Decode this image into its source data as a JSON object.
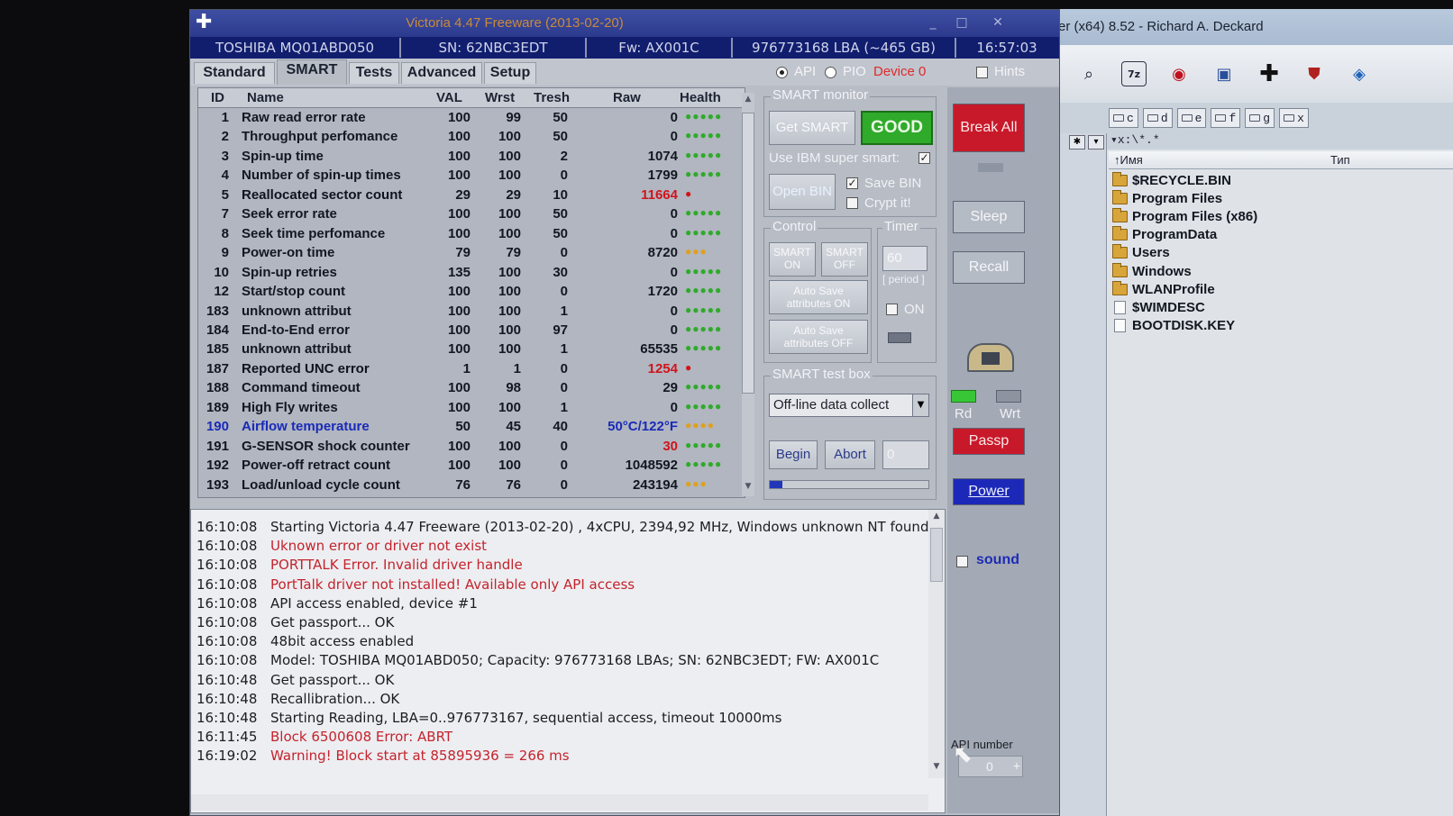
{
  "file_manager": {
    "title": "er (x64) 8.52 - Richard A. Deckard",
    "drives": [
      "c",
      "d",
      "e",
      "f",
      "g",
      "x"
    ],
    "path": "▾x:\\*.*",
    "columns": [
      "↑Имя",
      "Тип"
    ],
    "items": [
      {
        "name": "$RECYCLE.BIN",
        "kind": "folder"
      },
      {
        "name": "Program Files",
        "kind": "folder"
      },
      {
        "name": "Program Files (x86)",
        "kind": "folder"
      },
      {
        "name": "ProgramData",
        "kind": "folder"
      },
      {
        "name": "Users",
        "kind": "folder"
      },
      {
        "name": "Windows",
        "kind": "folder"
      },
      {
        "name": "WLANProfile",
        "kind": "folder"
      },
      {
        "name": "$WIMDESC",
        "kind": "file"
      },
      {
        "name": "BOOTDISK.KEY",
        "kind": "file"
      }
    ]
  },
  "window": {
    "title": "Victoria 4.47  Freeware (2013-02-20)",
    "min": "_",
    "max": "□",
    "close": "✕"
  },
  "infobar": {
    "model": "TOSHIBA MQ01ABD050",
    "serial": "SN: 62NBC3EDT",
    "firmware": "Fw: AX001C",
    "lba": "976773168 LBA (~465 GB)",
    "time": "16:57:03"
  },
  "tabs": [
    "Standard",
    "SMART",
    "Tests",
    "Advanced",
    "Setup"
  ],
  "access": {
    "api": "API",
    "pio": "PIO",
    "device": "Device 0",
    "hints": "Hints"
  },
  "smart_table": {
    "headers": {
      "id": "ID",
      "name": "Name",
      "val": "VAL",
      "wrst": "Wrst",
      "tresh": "Tresh",
      "raw": "Raw",
      "health": "Health"
    },
    "rows": [
      {
        "id": "1",
        "name": "Raw read error rate",
        "val": "100",
        "wrst": "99",
        "tresh": "50",
        "raw": "0",
        "health": "●●●●●",
        "tone": "ok"
      },
      {
        "id": "2",
        "name": "Throughput perfomance",
        "val": "100",
        "wrst": "100",
        "tresh": "50",
        "raw": "0",
        "health": "●●●●●",
        "tone": "ok"
      },
      {
        "id": "3",
        "name": "Spin-up time",
        "val": "100",
        "wrst": "100",
        "tresh": "2",
        "raw": "1074",
        "health": "●●●●●",
        "tone": "ok"
      },
      {
        "id": "4",
        "name": "Number of spin-up times",
        "val": "100",
        "wrst": "100",
        "tresh": "0",
        "raw": "1799",
        "health": "●●●●●",
        "tone": "ok"
      },
      {
        "id": "5",
        "name": "Reallocated sector count",
        "val": "29",
        "wrst": "29",
        "tresh": "10",
        "raw": "11664",
        "health": "●",
        "tone": "bad"
      },
      {
        "id": "7",
        "name": "Seek error rate",
        "val": "100",
        "wrst": "100",
        "tresh": "50",
        "raw": "0",
        "health": "●●●●●",
        "tone": "ok"
      },
      {
        "id": "8",
        "name": "Seek time perfomance",
        "val": "100",
        "wrst": "100",
        "tresh": "50",
        "raw": "0",
        "health": "●●●●●",
        "tone": "ok"
      },
      {
        "id": "9",
        "name": "Power-on time",
        "val": "79",
        "wrst": "79",
        "tresh": "0",
        "raw": "8720",
        "health": "●●●",
        "tone": "warn"
      },
      {
        "id": "10",
        "name": "Spin-up retries",
        "val": "135",
        "wrst": "100",
        "tresh": "30",
        "raw": "0",
        "health": "●●●●●",
        "tone": "ok"
      },
      {
        "id": "12",
        "name": "Start/stop count",
        "val": "100",
        "wrst": "100",
        "tresh": "0",
        "raw": "1720",
        "health": "●●●●●",
        "tone": "ok"
      },
      {
        "id": "183",
        "name": "unknown attribut",
        "val": "100",
        "wrst": "100",
        "tresh": "1",
        "raw": "0",
        "health": "●●●●●",
        "tone": "ok"
      },
      {
        "id": "184",
        "name": "End-to-End error",
        "val": "100",
        "wrst": "100",
        "tresh": "97",
        "raw": "0",
        "health": "●●●●●",
        "tone": "ok"
      },
      {
        "id": "185",
        "name": "unknown attribut",
        "val": "100",
        "wrst": "100",
        "tresh": "1",
        "raw": "65535",
        "health": "●●●●●",
        "tone": "ok"
      },
      {
        "id": "187",
        "name": "Reported UNC error",
        "val": "1",
        "wrst": "1",
        "tresh": "0",
        "raw": "1254",
        "health": "●",
        "tone": "bad"
      },
      {
        "id": "188",
        "name": "Command timeout",
        "val": "100",
        "wrst": "98",
        "tresh": "0",
        "raw": "29",
        "health": "●●●●●",
        "tone": "ok"
      },
      {
        "id": "189",
        "name": "High Fly writes",
        "val": "100",
        "wrst": "100",
        "tresh": "1",
        "raw": "0",
        "health": "●●●●●",
        "tone": "ok"
      },
      {
        "id": "190",
        "name": "Airflow temperature",
        "val": "50",
        "wrst": "45",
        "tresh": "40",
        "raw": "50°C/122°F",
        "health": "●●●●",
        "tone": "temp"
      },
      {
        "id": "191",
        "name": "G-SENSOR shock counter",
        "val": "100",
        "wrst": "100",
        "tresh": "0",
        "raw": "30",
        "health": "●●●●●",
        "tone": "rawred"
      },
      {
        "id": "192",
        "name": "Power-off retract count",
        "val": "100",
        "wrst": "100",
        "tresh": "0",
        "raw": "1048592",
        "health": "●●●●●",
        "tone": "ok"
      },
      {
        "id": "193",
        "name": "Load/unload cycle count",
        "val": "76",
        "wrst": "76",
        "tresh": "0",
        "raw": "243194",
        "health": "●●●",
        "tone": "warn"
      }
    ]
  },
  "monitor": {
    "group": "SMART monitor",
    "get_smart": "Get SMART",
    "status": "GOOD",
    "ibm_label": "Use IBM super smart:",
    "open_bin": "Open BIN",
    "save_bin": "Save BIN",
    "crypt": "Crypt it!",
    "control": "Control",
    "timer": "Timer",
    "smart_on": "SMART ON",
    "smart_off": "SMART OFF",
    "auto_on": "Auto Save attributes ON",
    "auto_off": "Auto Save attributes OFF",
    "timer_value": "60",
    "period": "[ period ]",
    "timer_on": "ON",
    "testbox": "SMART test box",
    "test_select": "Off-line data collect",
    "begin": "Begin",
    "abort": "Abort",
    "test_value": "0",
    "progress": 0.08
  },
  "side": {
    "break_all": "Break All",
    "sleep": "Sleep",
    "recall": "Recall",
    "rd": "Rd",
    "wrt": "Wrt",
    "passp": "Passp",
    "power": "Power",
    "sound": "sound",
    "api_number": "API number",
    "api_value": "0"
  },
  "log": [
    {
      "t": "16:10:08",
      "m": "Starting Victoria 4.47  Freeware (2013-02-20) , 4xCPU, 2394,92 MHz, Windows unknown NT found.",
      "err": false
    },
    {
      "t": "16:10:08",
      "m": "Uknown error or driver not exist",
      "err": true
    },
    {
      "t": "16:10:08",
      "m": "PORTTALK Error. Invalid driver handle",
      "err": true
    },
    {
      "t": "16:10:08",
      "m": "PortTalk driver not installed! Available only API access",
      "err": true
    },
    {
      "t": "16:10:08",
      "m": "API access enabled, device #1",
      "err": false
    },
    {
      "t": "16:10:08",
      "m": "Get passport... OK",
      "err": false
    },
    {
      "t": "16:10:08",
      "m": "48bit access enabled",
      "err": false
    },
    {
      "t": "16:10:08",
      "m": "Model: TOSHIBA MQ01ABD050; Capacity: 976773168 LBAs; SN: 62NBC3EDT; FW: AX001C",
      "err": false
    },
    {
      "t": "16:10:48",
      "m": "Get passport... OK",
      "err": false
    },
    {
      "t": "16:10:48",
      "m": "Recallibration... OK",
      "err": false
    },
    {
      "t": "16:10:48",
      "m": "Starting Reading, LBA=0..976773167, sequential access, timeout 10000ms",
      "err": false
    },
    {
      "t": "16:11:45",
      "m": "Block 6500608 Error: ABRT",
      "err": true
    },
    {
      "t": "16:19:02",
      "m": "Warning! Block start at 85895936 = 266 ms",
      "err": true
    }
  ],
  "colors": {
    "accent_blue": "#111e6e",
    "good_green": "#2faa2a",
    "bad_red": "#d0141c",
    "warn_orange": "#e0a01c",
    "temp_blue": "#1a2bb8"
  }
}
